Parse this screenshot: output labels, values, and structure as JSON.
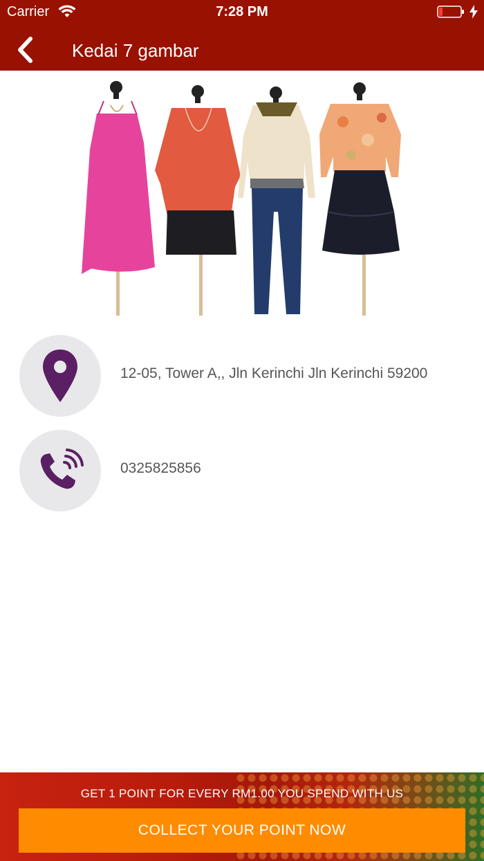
{
  "status_bar": {
    "carrier": "Carrier",
    "time": "7:28 PM"
  },
  "nav": {
    "title": "Kedai 7 gambar",
    "back_icon": "chevron-left-icon"
  },
  "store": {
    "address": "12-05, Tower A,, Jln Kerinchi Jln Kerinchi 59200",
    "phone": "0325825856",
    "address_icon": "location-pin-icon",
    "phone_icon": "phone-icon"
  },
  "promo": {
    "text": "GET 1 POINT FOR EVERY RM1.00 YOU SPEND WITH US",
    "button_label": "COLLECT YOUR POINT NOW"
  },
  "colors": {
    "header": "#991100",
    "icon": "#5b1f63",
    "button": "#ff8c00"
  }
}
